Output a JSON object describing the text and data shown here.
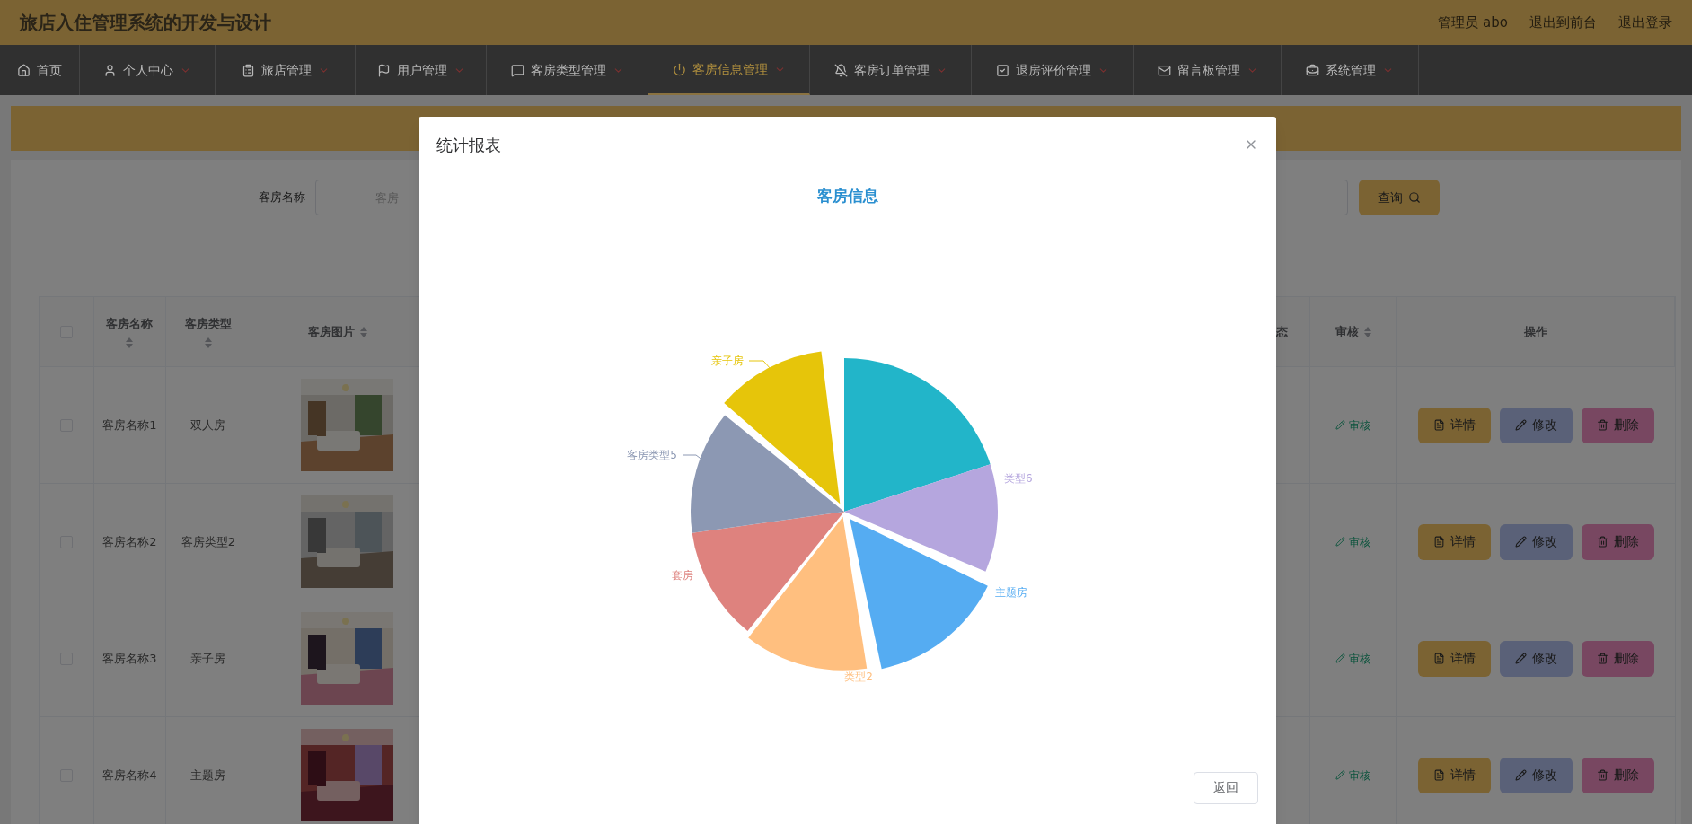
{
  "header": {
    "title": "旅店入住管理系统的开发与设计",
    "links": [
      "管理员 abo",
      "退出到前台",
      "退出登录"
    ]
  },
  "nav": [
    {
      "label": "首页",
      "has_menu": false,
      "selected": false
    },
    {
      "label": "个人中心",
      "has_menu": true,
      "selected": false
    },
    {
      "label": "旅店管理",
      "has_menu": true,
      "selected": false
    },
    {
      "label": "用户管理",
      "has_menu": true,
      "selected": false
    },
    {
      "label": "客房类型管理",
      "has_menu": true,
      "selected": false
    },
    {
      "label": "客房信息管理",
      "has_menu": true,
      "selected": true
    },
    {
      "label": "客房订单管理",
      "has_menu": true,
      "selected": false
    },
    {
      "label": "退房评价管理",
      "has_menu": true,
      "selected": false
    },
    {
      "label": "留言板管理",
      "has_menu": true,
      "selected": false
    },
    {
      "label": "系统管理",
      "has_menu": true,
      "selected": false
    }
  ],
  "search": {
    "label": "客房名称",
    "placeholder": "客房",
    "button": "查询"
  },
  "table": {
    "select_all": {
      "checked": false
    },
    "columns": [
      {
        "label": "客房名称",
        "sortable": true
      },
      {
        "label": "客房类型",
        "sortable": true
      },
      {
        "label": "客房图片",
        "sortable": true
      },
      {
        "label": "态",
        "sortable": false
      },
      {
        "label": "审核",
        "sortable": true
      },
      {
        "label": "操作",
        "sortable": false
      }
    ],
    "rows": [
      {
        "checked": false,
        "name": "客房名称1",
        "type": "双人房",
        "photo": {
          "kind": "picture"
        },
        "review": "审核",
        "actions": [
          {
            "kind": "detail",
            "label": "详情"
          },
          {
            "kind": "edit",
            "label": "修改"
          },
          {
            "kind": "delete",
            "label": "删除"
          }
        ]
      },
      {
        "checked": false,
        "name": "客房名称2",
        "type": "客房类型2",
        "photo": {
          "kind": "picture"
        },
        "review": "审核",
        "actions": [
          {
            "kind": "detail",
            "label": "详情"
          },
          {
            "kind": "edit",
            "label": "修改"
          },
          {
            "kind": "delete",
            "label": "删除"
          }
        ]
      },
      {
        "checked": false,
        "name": "客房名称3",
        "type": "亲子房",
        "photo": {
          "kind": "picture"
        },
        "review": "审核",
        "actions": [
          {
            "kind": "detail",
            "label": "详情"
          },
          {
            "kind": "edit",
            "label": "修改"
          },
          {
            "kind": "delete",
            "label": "删除"
          }
        ]
      },
      {
        "checked": false,
        "name": "客房名称4",
        "type": "主题房",
        "photo": {
          "kind": "picture"
        },
        "review": "审核",
        "actions": [
          {
            "kind": "detail",
            "label": "详情"
          },
          {
            "kind": "edit",
            "label": "修改"
          },
          {
            "kind": "delete",
            "label": "删除"
          }
        ]
      }
    ]
  },
  "modal": {
    "title": "统计报表",
    "chart_title": "客房信息",
    "slices": [
      {
        "color": "#22b5c9"
      },
      {
        "label": "类型6",
        "color": "#b5a6de"
      },
      {
        "label": "主题房",
        "color": "#55acf2"
      },
      {
        "label": "类型2",
        "color": "#ffbf7f"
      },
      {
        "label": "套房",
        "color": "#de827e"
      },
      {
        "label": "客房类型5",
        "color": "#8c98b3"
      },
      {
        "label": "亲子房",
        "color": "#e6c50a"
      }
    ],
    "footer_button": "返回"
  }
}
